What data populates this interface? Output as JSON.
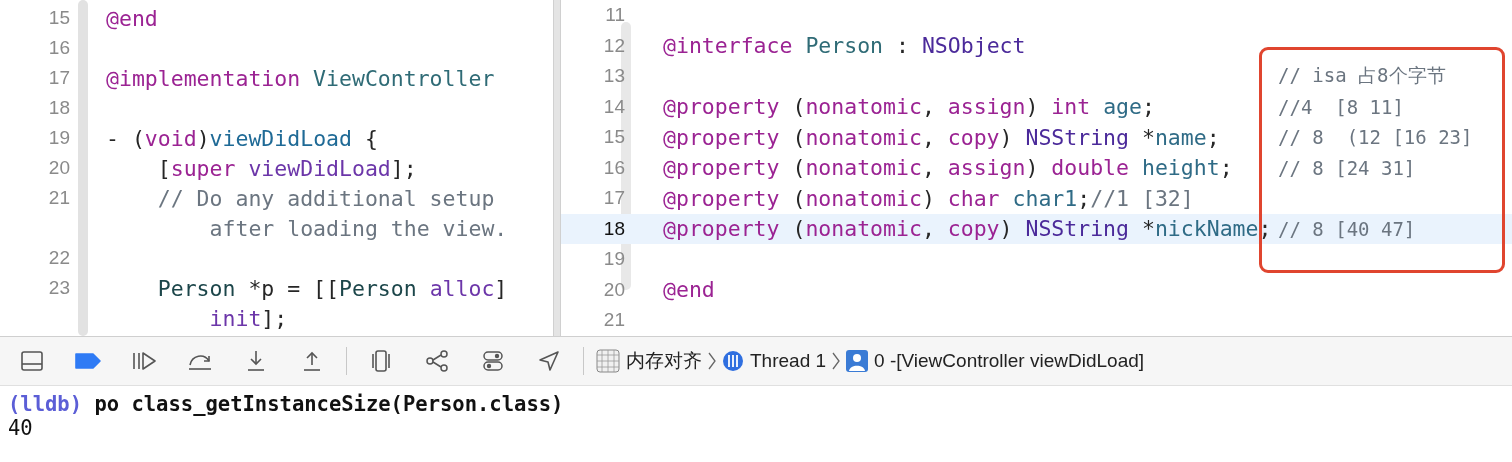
{
  "left_editor": {
    "lines": [
      {
        "number": "15",
        "tokens": [
          {
            "text": "@end",
            "kind": "keyword"
          }
        ]
      },
      {
        "number": "16"
      },
      {
        "number": "17",
        "tokens": [
          {
            "text": "@implementation",
            "kind": "keyword"
          },
          {
            "text": " ViewController",
            "kind": "class-decl"
          }
        ]
      },
      {
        "number": "18"
      },
      {
        "number": "19",
        "tokens": [
          {
            "text": "- (",
            "kind": "plain"
          },
          {
            "text": "void",
            "kind": "keyword"
          },
          {
            "text": ")",
            "kind": "plain"
          },
          {
            "text": "viewDidLoad",
            "kind": "method-decl"
          },
          {
            "text": " {",
            "kind": "plain"
          }
        ]
      },
      {
        "number": "20",
        "tokens": [
          {
            "text": "    [",
            "kind": "plain"
          },
          {
            "text": "super",
            "kind": "keyword"
          },
          {
            "text": " viewDidLoad",
            "kind": "method"
          },
          {
            "text": "];",
            "kind": "plain"
          }
        ]
      },
      {
        "number": "21",
        "tokens": [
          {
            "text": "    // Do any additional setup",
            "kind": "comment"
          }
        ],
        "continuation": [
          {
            "text": "        after loading the view.",
            "kind": "comment"
          }
        ]
      },
      {
        "number": "22"
      },
      {
        "number": "23",
        "tokens": [
          {
            "text": "    Person",
            "kind": "class"
          },
          {
            "text": " *p = [[",
            "kind": "plain"
          },
          {
            "text": "Person",
            "kind": "class"
          },
          {
            "text": " alloc",
            "kind": "method"
          },
          {
            "text": "]",
            "kind": "plain"
          }
        ],
        "continuation": [
          {
            "text": "        init",
            "kind": "method"
          },
          {
            "text": "];",
            "kind": "plain"
          }
        ]
      }
    ]
  },
  "right_editor": {
    "lines": [
      {
        "number": "11",
        "current": false
      },
      {
        "number": "12",
        "current": false,
        "tokens": [
          {
            "text": "@interface",
            "kind": "keyword"
          },
          {
            "text": " Person",
            "kind": "class-decl"
          },
          {
            "text": " : ",
            "kind": "plain"
          },
          {
            "text": "NSObject",
            "kind": "type"
          }
        ]
      },
      {
        "number": "13",
        "current": false,
        "note": "// isa 占8个字节"
      },
      {
        "number": "14",
        "current": false,
        "note": "//4  [8 11]",
        "tokens": [
          {
            "text": "@property",
            "kind": "keyword"
          },
          {
            "text": " (",
            "kind": "plain"
          },
          {
            "text": "nonatomic",
            "kind": "keyword"
          },
          {
            "text": ", ",
            "kind": "plain"
          },
          {
            "text": "assign",
            "kind": "keyword"
          },
          {
            "text": ") ",
            "kind": "plain"
          },
          {
            "text": "int",
            "kind": "keyword"
          },
          {
            "text": " age",
            "kind": "ident"
          },
          {
            "text": ";",
            "kind": "plain"
          }
        ]
      },
      {
        "number": "15",
        "current": false,
        "note": "// 8  (12 [16 23]",
        "tokens": [
          {
            "text": "@property",
            "kind": "keyword"
          },
          {
            "text": " (",
            "kind": "plain"
          },
          {
            "text": "nonatomic",
            "kind": "keyword"
          },
          {
            "text": ", ",
            "kind": "plain"
          },
          {
            "text": "copy",
            "kind": "keyword"
          },
          {
            "text": ") ",
            "kind": "plain"
          },
          {
            "text": "NSString",
            "kind": "type"
          },
          {
            "text": " *",
            "kind": "plain"
          },
          {
            "text": "name",
            "kind": "ident"
          },
          {
            "text": ";",
            "kind": "plain"
          }
        ]
      },
      {
        "number": "16",
        "current": false,
        "note": "// 8 [24 31]",
        "tokens": [
          {
            "text": "@property",
            "kind": "keyword"
          },
          {
            "text": " (",
            "kind": "plain"
          },
          {
            "text": "nonatomic",
            "kind": "keyword"
          },
          {
            "text": ", ",
            "kind": "plain"
          },
          {
            "text": "assign",
            "kind": "keyword"
          },
          {
            "text": ") ",
            "kind": "plain"
          },
          {
            "text": "double",
            "kind": "keyword"
          },
          {
            "text": " height",
            "kind": "ident"
          },
          {
            "text": ";",
            "kind": "plain"
          }
        ]
      },
      {
        "number": "17",
        "current": false,
        "tokens": [
          {
            "text": "@property",
            "kind": "keyword"
          },
          {
            "text": " (",
            "kind": "plain"
          },
          {
            "text": "nonatomic",
            "kind": "keyword"
          },
          {
            "text": ") ",
            "kind": "plain"
          },
          {
            "text": "char",
            "kind": "keyword"
          },
          {
            "text": " char1",
            "kind": "ident"
          },
          {
            "text": ";",
            "kind": "plain"
          },
          {
            "text": "//1 [32]",
            "kind": "comment"
          }
        ]
      },
      {
        "number": "18",
        "current": true,
        "note": "// 8 [40 47]",
        "tokens": [
          {
            "text": "@property",
            "kind": "keyword"
          },
          {
            "text": " (",
            "kind": "plain"
          },
          {
            "text": "nonatomic",
            "kind": "keyword"
          },
          {
            "text": ", ",
            "kind": "plain"
          },
          {
            "text": "copy",
            "kind": "keyword"
          },
          {
            "text": ") ",
            "kind": "plain"
          },
          {
            "text": "NSString",
            "kind": "type"
          },
          {
            "text": " *",
            "kind": "plain"
          },
          {
            "text": "nickName",
            "kind": "ident"
          },
          {
            "text": ";",
            "kind": "plain"
          }
        ]
      },
      {
        "number": "19",
        "current": false
      },
      {
        "number": "20",
        "current": false,
        "tokens": [
          {
            "text": "@end",
            "kind": "keyword"
          }
        ]
      },
      {
        "number": "21",
        "current": false
      }
    ]
  },
  "debug_bar": {
    "breakpoints_active": true,
    "breadcrumb": [
      {
        "label": "内存对齐",
        "kind": "target"
      },
      {
        "label": "Thread 1",
        "kind": "thread"
      },
      {
        "label": "0 -[ViewController viewDidLoad]",
        "kind": "frame"
      }
    ]
  },
  "console": {
    "lines": [
      {
        "kind": "command",
        "prompt": "(lldb)",
        "text": "po class_getInstanceSize(Person.class)"
      },
      {
        "kind": "output",
        "text": "40"
      }
    ]
  }
}
